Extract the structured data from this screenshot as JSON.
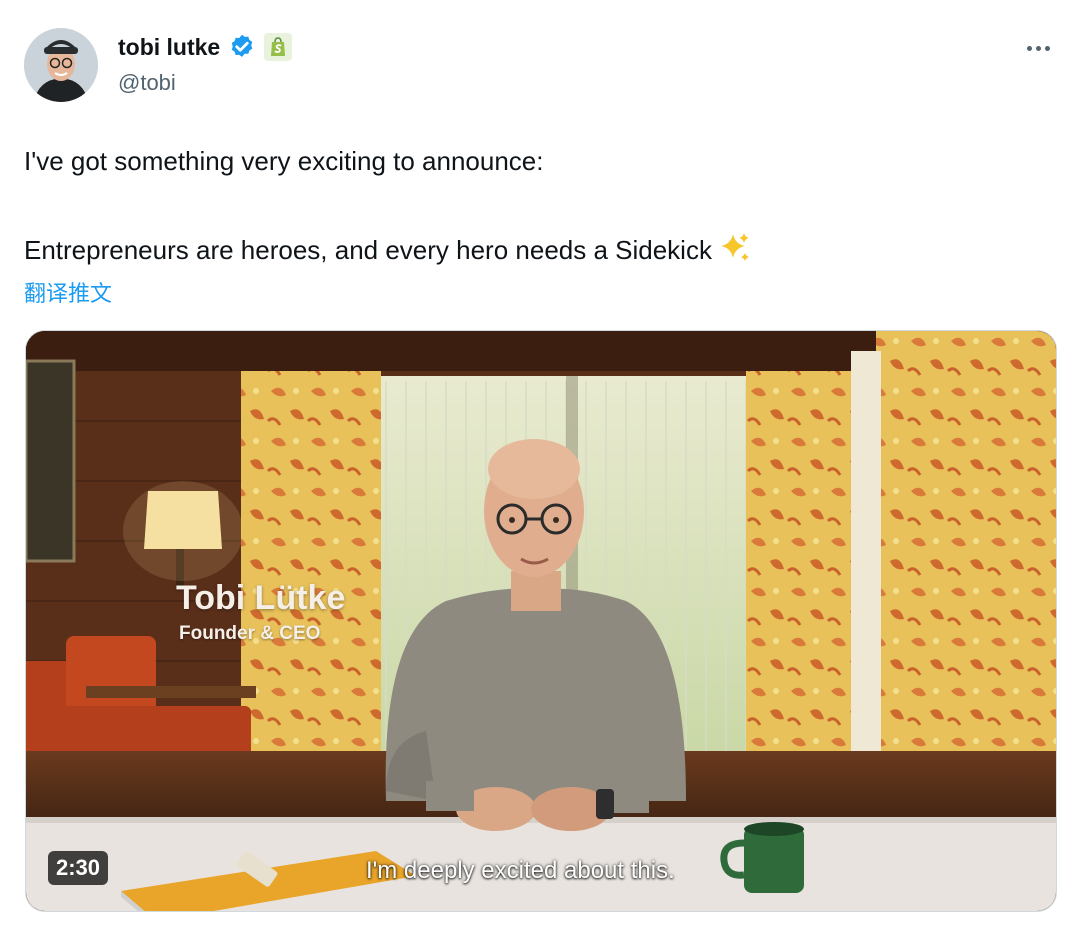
{
  "author": {
    "display_name": "tobi lutke",
    "handle": "@tobi"
  },
  "tweet": {
    "line1": "I've got something very exciting to announce:",
    "line2": "Entrepreneurs are heroes, and every hero needs a Sidekick",
    "translate_label": "翻译推文"
  },
  "video": {
    "lower_third_name": "Tobi Lütke",
    "lower_third_title": "Founder & CEO",
    "subtitle": "I'm deeply excited about this.",
    "duration": "2:30"
  },
  "icons": {
    "verified": "verified-badge-icon",
    "affiliation": "shopify-bag-icon",
    "more": "more-icon",
    "sparkles": "sparkles-emoji"
  },
  "colors": {
    "accent": "#1d9bf0",
    "secondary_text": "#536471",
    "shopify_green": "#95bf47"
  }
}
